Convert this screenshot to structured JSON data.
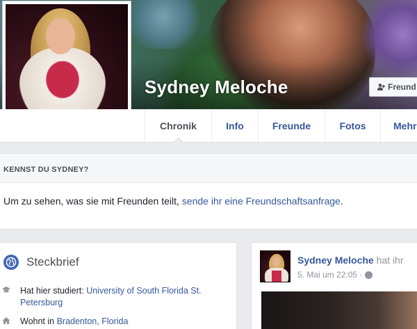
{
  "profile": {
    "name": "Sydney Meloche"
  },
  "header": {
    "friend_button_label": "Freund"
  },
  "nav": {
    "tabs": [
      {
        "label": "Chronik",
        "active": true
      },
      {
        "label": "Info"
      },
      {
        "label": "Freunde"
      },
      {
        "label": "Fotos"
      },
      {
        "label": "Mehr"
      }
    ]
  },
  "kennst": {
    "heading": "KENNST DU SYDNEY?",
    "text_prefix": "Um zu sehen, was sie mit Freunden teilt, ",
    "link": "sende ihr eine Freundschaftsanfrage",
    "text_suffix": "."
  },
  "intro": {
    "title": "Steckbrief",
    "rows": [
      {
        "icon": "education-icon",
        "prefix": "Hat hier studiert: ",
        "link": "University of South Florida St. Petersburg"
      },
      {
        "icon": "home-icon",
        "prefix": "Wohnt in ",
        "link": "Bradenton, Florida"
      }
    ]
  },
  "post": {
    "author": "Sydney Meloche",
    "action": " hat ihr",
    "timestamp": "5. Mai um 22:05 ·",
    "privacy_icon": "globe-icon"
  },
  "colors": {
    "link": "#365899",
    "bg": "#e9ebee",
    "globe_blue": "#4267b2"
  }
}
